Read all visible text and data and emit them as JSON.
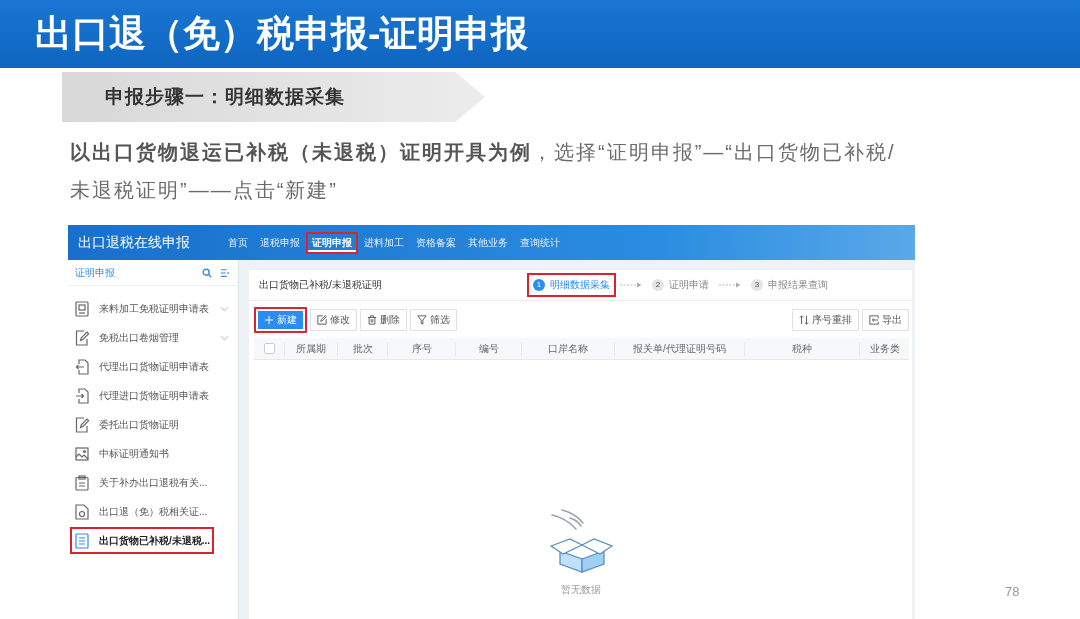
{
  "title_bar": {
    "title": "出口退（免）税申报-证明申报"
  },
  "step_banner": {
    "text": "申报步骤一：明细数据采集"
  },
  "instruction": "**以出口货物退运已补税（未退税）证明开具为例**，选择“证明申报”—“出口货物已补税/未退税证明”——点击“新建”",
  "screenshot": {
    "app_title": "出口退税在线申报",
    "nav": [
      {
        "label": "首页",
        "selected": false,
        "highlighted": false
      },
      {
        "label": "退税申报",
        "selected": false,
        "highlighted": false
      },
      {
        "label": "证明申报",
        "selected": true,
        "highlighted": true
      },
      {
        "label": "进料加工",
        "selected": false,
        "highlighted": false
      },
      {
        "label": "资格备案",
        "selected": false,
        "highlighted": false
      },
      {
        "label": "其他业务",
        "selected": false,
        "highlighted": false
      },
      {
        "label": "查询统计",
        "selected": false,
        "highlighted": false
      }
    ],
    "sidebar": {
      "title": "证明申报",
      "items": [
        {
          "label": "来料加工免税证明申请表",
          "expandable": true,
          "selected": false,
          "highlighted": false
        },
        {
          "label": "免税出口卷烟管理",
          "expandable": true,
          "selected": false,
          "highlighted": false
        },
        {
          "label": "代理出口货物证明申请表",
          "expandable": false,
          "selected": false,
          "highlighted": false
        },
        {
          "label": "代理进口货物证明申请表",
          "expandable": false,
          "selected": false,
          "highlighted": false
        },
        {
          "label": "委托出口货物证明",
          "expandable": false,
          "selected": false,
          "highlighted": false
        },
        {
          "label": "中标证明通知书",
          "expandable": false,
          "selected": false,
          "highlighted": false
        },
        {
          "label": "关于补办出口退税有关...",
          "expandable": false,
          "selected": false,
          "highlighted": false
        },
        {
          "label": "出口退（免）税相关证...",
          "expandable": false,
          "selected": false,
          "highlighted": false
        },
        {
          "label": "出口货物已补税/未退税...",
          "expandable": false,
          "selected": true,
          "highlighted": true
        }
      ]
    },
    "panel": {
      "title": "出口货物已补税/未退税证明",
      "steps": [
        {
          "number": "1",
          "label": "明细数据采集",
          "selected": true,
          "highlighted": true
        },
        {
          "number": "2",
          "label": "证明申请",
          "selected": false,
          "highlighted": false
        },
        {
          "number": "3",
          "label": "申报结果查询",
          "selected": false,
          "highlighted": false
        }
      ]
    },
    "toolbar": {
      "left": [
        {
          "label": "新建",
          "kind": "primary",
          "highlighted": true
        },
        {
          "label": "修改",
          "kind": "default",
          "highlighted": false
        },
        {
          "label": "删除",
          "kind": "default",
          "highlighted": false
        },
        {
          "label": "筛选",
          "kind": "default",
          "highlighted": false
        }
      ],
      "right": [
        {
          "label": "序号重排",
          "kind": "default",
          "highlighted": false
        },
        {
          "label": "导出",
          "kind": "default",
          "highlighted": false
        }
      ]
    },
    "table": {
      "select_all": {
        "checked": false
      },
      "columns": [
        "所属期",
        "批次",
        "序号",
        "编号",
        "口岸名称",
        "报关单/代理证明号码",
        "税种",
        "业务类"
      ]
    },
    "empty_state": {
      "text": "暂无数据"
    }
  },
  "page_number": "78"
}
